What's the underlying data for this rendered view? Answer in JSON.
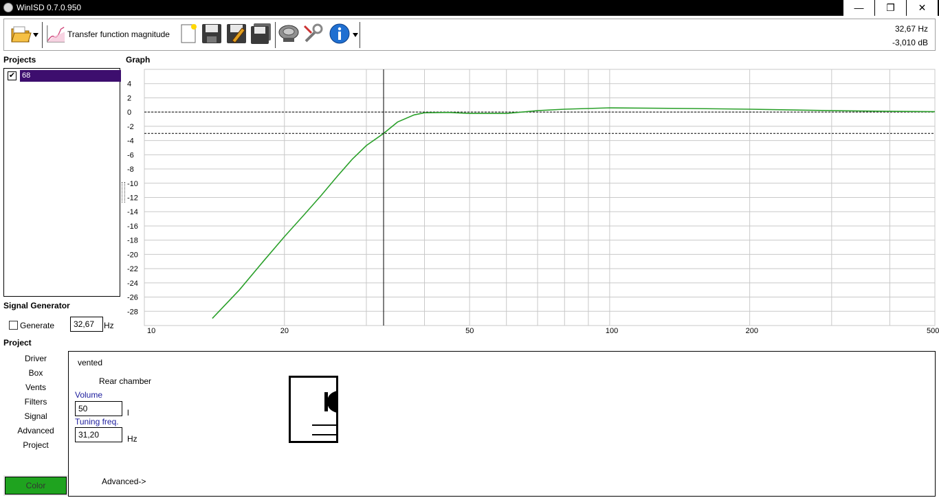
{
  "window": {
    "title": "WinISD 0.7.0.950",
    "minimize": "—",
    "restore": "❐",
    "close": "✕"
  },
  "toolbar": {
    "graph_selector_label": "Transfer function magnitude",
    "readout_freq": "32,67 Hz",
    "readout_db": "-3,010 dB",
    "icons": [
      "open-folder-icon",
      "chart-icon",
      "new-project-icon",
      "save-icon",
      "save-as-icon",
      "save-all-icon",
      "driver-icon",
      "tools-icon",
      "info-icon"
    ]
  },
  "projects": {
    "title": "Projects",
    "items": [
      {
        "name": "68",
        "checked": true
      }
    ]
  },
  "graph": {
    "title": "Graph"
  },
  "signal_generator": {
    "title": "Signal Generator",
    "generate_label": "Generate",
    "freq_value": "32,67",
    "freq_unit": "Hz"
  },
  "project": {
    "title": "Project",
    "nav": [
      "Driver",
      "Box",
      "Vents",
      "Filters",
      "Signal",
      "Advanced",
      "Project"
    ],
    "box_type": "vented",
    "chamber_label": "Rear chamber",
    "volume_label": "Volume",
    "volume_value": "50",
    "volume_unit": "l",
    "tuning_label": "Tuning freq.",
    "tuning_value": "31,20",
    "tuning_unit": "Hz",
    "advanced_link": "Advanced->",
    "color_button": "Color",
    "color_value": "#1fa31f"
  },
  "chart_data": {
    "type": "line",
    "x_scale": "log",
    "xlim": [
      10,
      500
    ],
    "ylim": [
      -30,
      6
    ],
    "x_ticks": [
      10,
      20,
      50,
      100,
      200,
      500
    ],
    "y_ticks": [
      4,
      2,
      0,
      -2,
      -4,
      -6,
      -8,
      -10,
      -12,
      -14,
      -16,
      -18,
      -20,
      -22,
      -24,
      -26,
      -28
    ],
    "reference_lines_db": [
      0,
      -3
    ],
    "cursor_freq": 32.67,
    "grid": true,
    "series": [
      {
        "color": "#2aa02a",
        "x": [
          14.0,
          16,
          18,
          20,
          22,
          24,
          26,
          28,
          30,
          32.67,
          35,
          38,
          40,
          45,
          50,
          60,
          70,
          80,
          100,
          150,
          200,
          300,
          400,
          500
        ],
        "y": [
          -29.0,
          -25.0,
          -21.0,
          -17.5,
          -14.5,
          -11.7,
          -9.0,
          -6.6,
          -4.7,
          -3.0,
          -1.4,
          -0.4,
          -0.1,
          -0.05,
          -0.2,
          -0.2,
          0.2,
          0.4,
          0.6,
          0.5,
          0.4,
          0.2,
          0.1,
          0.05
        ]
      }
    ]
  }
}
